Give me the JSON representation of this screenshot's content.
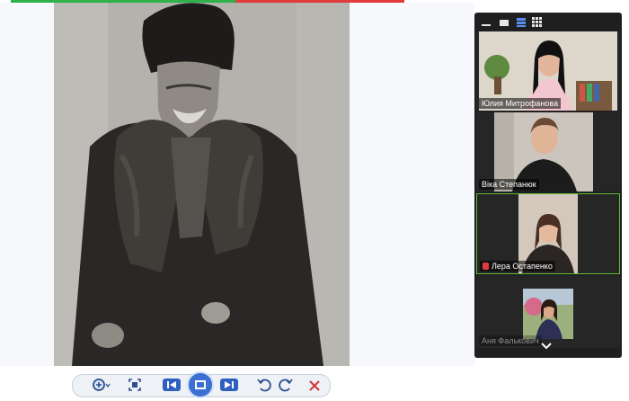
{
  "progress": {
    "fraction": 0.57,
    "fill_color": "#2fb24a",
    "track_color": "#e23b3b"
  },
  "viewer": {
    "photo_subject": "sepia-portrait-man-in-fur-hat-and-sheepskin-coat"
  },
  "zoom": {
    "toolbar_icons": [
      "minimize-icon",
      "speaker-view-icon",
      "strip-view-icon",
      "gallery-view-icon"
    ],
    "participants": [
      {
        "name": "Юлия Митрофанова",
        "muted": false
      },
      {
        "name": "Віка Степанюк",
        "muted": false
      },
      {
        "name": "Лера  Остапенко",
        "muted": true,
        "active": true
      },
      {
        "name": "Аня Фалькович",
        "muted": false
      }
    ],
    "active_color": "#5cbc3a",
    "scroll_icon": "chevron-down-icon"
  },
  "viewer_toolbar": {
    "icons": [
      "zoom-in-icon",
      "fit-screen-icon",
      "previous-icon",
      "slideshow-icon",
      "next-icon",
      "rotate-left-icon",
      "rotate-right-icon",
      "delete-icon"
    ],
    "accent_color": "#3b6fd0"
  }
}
